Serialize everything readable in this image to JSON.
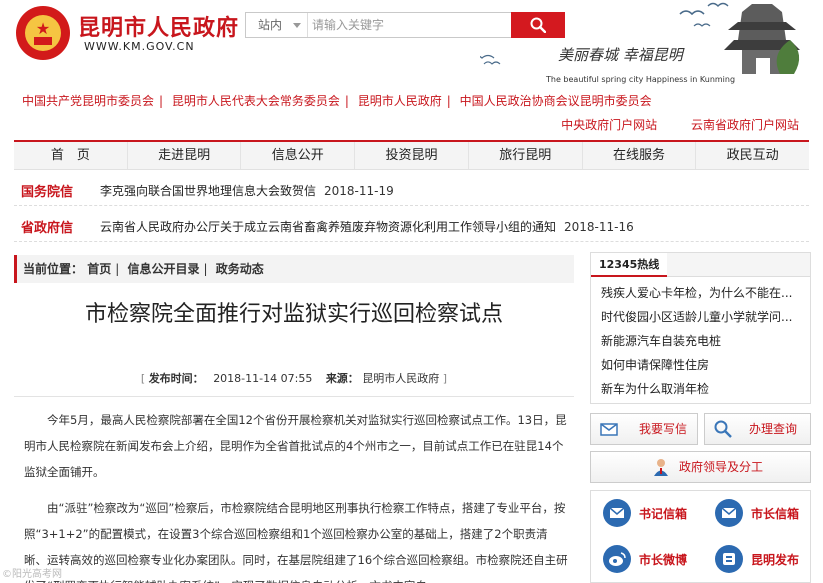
{
  "header": {
    "site_title": "昆明市人民政府",
    "site_url": "WWW.KM.GOV.CN",
    "search": {
      "scope_label": "站内",
      "placeholder": "请输入关键字"
    },
    "banner": {
      "slogan": "美丽春城 幸福昆明",
      "slogan_en": "The beautiful spring city  Happiness in Kunming"
    }
  },
  "org_links": [
    "中国共产党昆明市委员会",
    "昆明市人民代表大会常务委员会",
    "昆明市人民政府",
    "中国人民政治协商会议昆明市委员会"
  ],
  "portal_links": [
    "中央政府门户网站",
    "云南省政府门户网站"
  ],
  "nav": [
    "首　页",
    "走进昆明",
    "信息公开",
    "投资昆明",
    "旅行昆明",
    "在线服务",
    "政民互动"
  ],
  "notices": [
    {
      "tag": "国务院信",
      "text": "李克强向联合国世界地理信息大会致贺信",
      "date": "2018-11-19"
    },
    {
      "tag": "省政府信",
      "text": "云南省人民政府办公厅关于成立云南省畜禽养殖废弃物资源化利用工作领导小组的通知",
      "date": "2018-11-16"
    }
  ],
  "breadcrumb": {
    "label": "当前位置：",
    "items": [
      "首页",
      "信息公开目录",
      "政务动态"
    ]
  },
  "article": {
    "title": "市检察院全面推行对监狱实行巡回检察试点",
    "meta": {
      "publish_label": "发布时间：",
      "publish_time": "2018-11-14 07:55",
      "source_label": "来源：",
      "source": "昆明市人民政府"
    },
    "paragraphs": [
      "今年5月，最高人民检察院部署在全国12个省份开展检察机关对监狱实行巡回检察试点工作。13日，昆明市人民检察院在新闻发布会上介绍，昆明作为全省首批试点的4个州市之一，目前试点工作已在驻昆14个监狱全面铺开。",
      "由“派驻”检察改为“巡回”检察后，市检察院结合昆明地区刑事执行检察工作特点，搭建了专业平台，按照“3+1+2”的配置模式，在设置3个综合巡回检察组和1个巡回检察办公室的基础上，搭建了2个职责清晰、运转高效的巡回检察专业化办案团队。同时，在基层院组建了16个综合巡回检察组。市检察院还自主研发了“刑罚变更执行智能辅助办案系统”，实现了数据信息自动分析、文书内容自"
    ]
  },
  "sidebar": {
    "hotline_title": "12345热线",
    "hotline_items": [
      "残疾人爱心卡年检，为什么不能在...",
      "时代俊园小区适龄儿童小学就学问...",
      "新能源汽车自装充电桩",
      "如何申请保障性住房",
      "新车为什么取消年检"
    ],
    "services": {
      "write_letter": "我要写信",
      "check_status": "办理查询",
      "leaders": "政府领导及分工"
    },
    "channels": {
      "secretary_mailbox": "书记信箱",
      "mayor_mailbox": "市长信箱",
      "mayor_weibo": "市长微博",
      "kunming_release": "昆明发布"
    }
  },
  "colors": {
    "brand_red": "#c8161d",
    "icon_blue": "#2c6ab1"
  },
  "watermark": "©阳光高考网"
}
